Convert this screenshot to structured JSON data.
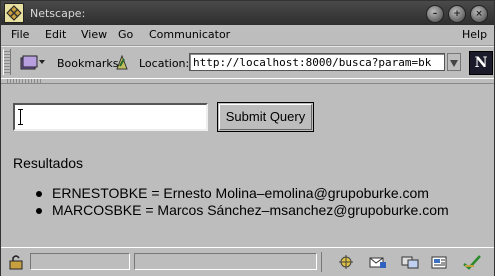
{
  "window": {
    "title": "Netscape:"
  },
  "menubar": {
    "items": [
      "File",
      "Edit",
      "View",
      "Go",
      "Communicator"
    ],
    "help": "Help"
  },
  "toolbar": {
    "bookmarks_label": "Bookmarks",
    "location_label": "Location:",
    "url": "http://localhost:8000/busca?param=bk",
    "brand_letter": "N"
  },
  "form": {
    "query_value": "",
    "submit_label": "Submit Query"
  },
  "results": {
    "heading": "Resultados",
    "items": [
      "ERNESTOBKE = Ernesto Molina–emolina@grupoburke.com",
      "MARCOSBKE = Marcos Sánchez–msanchez@grupoburke.com"
    ]
  },
  "statusbar": {
    "message": "",
    "tray_icons": [
      "component-bar-icon",
      "mail-icon",
      "discussions-icon",
      "composer-icon",
      "security-check-icon"
    ]
  },
  "colors": {
    "chrome": "#bdbdbd",
    "titlebar": "#3a3a3a"
  }
}
